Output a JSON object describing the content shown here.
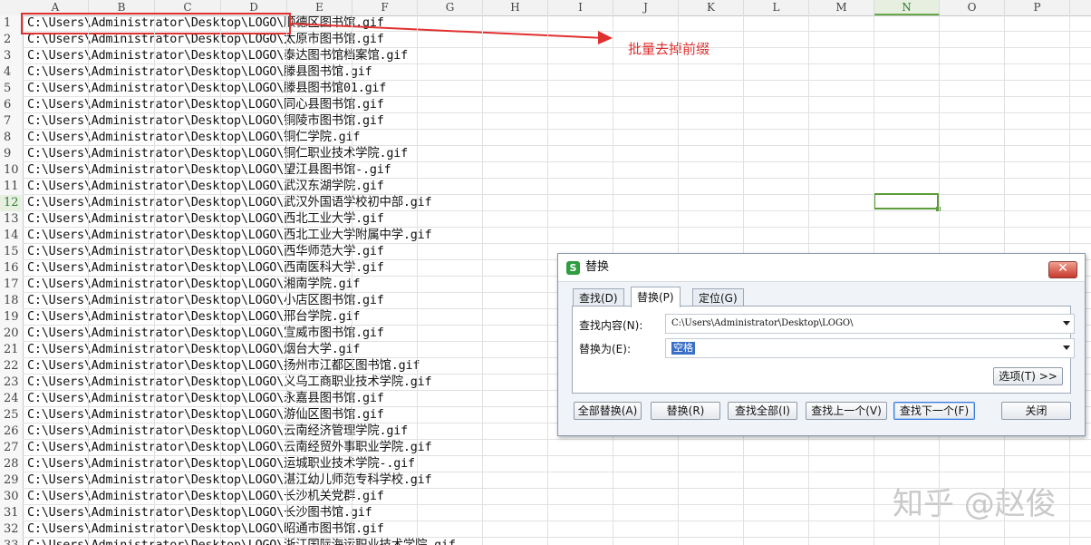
{
  "columns": [
    "A",
    "B",
    "C",
    "D",
    "E",
    "F",
    "G",
    "H",
    "I",
    "J",
    "K",
    "L",
    "M",
    "N",
    "O",
    "P"
  ],
  "active_column": "N",
  "active_row": 12,
  "rows": [
    "C:\\Users\\Administrator\\Desktop\\LOGO\\顺德区图书馆.gif",
    "C:\\Users\\Administrator\\Desktop\\LOGO\\太原市图书馆.gif",
    "C:\\Users\\Administrator\\Desktop\\LOGO\\泰达图书馆档案馆.gif",
    "C:\\Users\\Administrator\\Desktop\\LOGO\\滕县图书馆.gif",
    "C:\\Users\\Administrator\\Desktop\\LOGO\\滕县图书馆01.gif",
    "C:\\Users\\Administrator\\Desktop\\LOGO\\同心县图书馆.gif",
    "C:\\Users\\Administrator\\Desktop\\LOGO\\铜陵市图书馆.gif",
    "C:\\Users\\Administrator\\Desktop\\LOGO\\铜仁学院.gif",
    "C:\\Users\\Administrator\\Desktop\\LOGO\\铜仁职业技术学院.gif",
    "C:\\Users\\Administrator\\Desktop\\LOGO\\望江县图书馆-.gif",
    "C:\\Users\\Administrator\\Desktop\\LOGO\\武汉东湖学院.gif",
    "C:\\Users\\Administrator\\Desktop\\LOGO\\武汉外国语学校初中部.gif",
    "C:\\Users\\Administrator\\Desktop\\LOGO\\西北工业大学.gif",
    "C:\\Users\\Administrator\\Desktop\\LOGO\\西北工业大学附属中学.gif",
    "C:\\Users\\Administrator\\Desktop\\LOGO\\西华师范大学.gif",
    "C:\\Users\\Administrator\\Desktop\\LOGO\\西南医科大学.gif",
    "C:\\Users\\Administrator\\Desktop\\LOGO\\湘南学院.gif",
    "C:\\Users\\Administrator\\Desktop\\LOGO\\小店区图书馆.gif",
    "C:\\Users\\Administrator\\Desktop\\LOGO\\邢台学院.gif",
    "C:\\Users\\Administrator\\Desktop\\LOGO\\宣威市图书馆.gif",
    "C:\\Users\\Administrator\\Desktop\\LOGO\\烟台大学.gif",
    "C:\\Users\\Administrator\\Desktop\\LOGO\\扬州市江都区图书馆.gif",
    "C:\\Users\\Administrator\\Desktop\\LOGO\\义乌工商职业技术学院.gif",
    "C:\\Users\\Administrator\\Desktop\\LOGO\\永嘉县图书馆.gif",
    "C:\\Users\\Administrator\\Desktop\\LOGO\\游仙区图书馆.gif",
    "C:\\Users\\Administrator\\Desktop\\LOGO\\云南经济管理学院.gif",
    "C:\\Users\\Administrator\\Desktop\\LOGO\\云南经贸外事职业学院.gif",
    "C:\\Users\\Administrator\\Desktop\\LOGO\\运城职业技术学院-.gif",
    "C:\\Users\\Administrator\\Desktop\\LOGO\\湛江幼儿师范专科学校.gif",
    "C:\\Users\\Administrator\\Desktop\\LOGO\\长沙机关党群.gif",
    "C:\\Users\\Administrator\\Desktop\\LOGO\\长沙图书馆.gif",
    "C:\\Users\\Administrator\\Desktop\\LOGO\\昭通市图书馆.gif",
    "C:\\Users\\Administrator\\Desktop\\LOGO\\浙江国际海运职业技术学院.gif"
  ],
  "annotation": "批量去掉前缀",
  "watermark": "知乎 @赵俊",
  "colors": {
    "annotation_red": "#e03030",
    "selection_green": "#5b9b3a",
    "app_green": "#2e9e3e"
  },
  "dialog": {
    "title": "替换",
    "logo": "S",
    "close": "✕",
    "tabs": [
      {
        "label": "查找(D)",
        "active": false
      },
      {
        "label": "替换(P)",
        "active": true
      },
      {
        "label": "定位(G)",
        "active": false
      }
    ],
    "find_label": "查找内容(N):",
    "find_value": "C:\\Users\\Administrator\\Desktop\\LOGO\\",
    "replace_label": "替换为(E):",
    "replace_value": "空格",
    "options_button": "选项(T) >>",
    "buttons": {
      "replace_all": "全部替换(A)",
      "replace": "替换(R)",
      "find_all": "查找全部(I)",
      "find_prev": "查找上一个(V)",
      "find_next": "查找下一个(F)",
      "close": "关闭"
    }
  }
}
